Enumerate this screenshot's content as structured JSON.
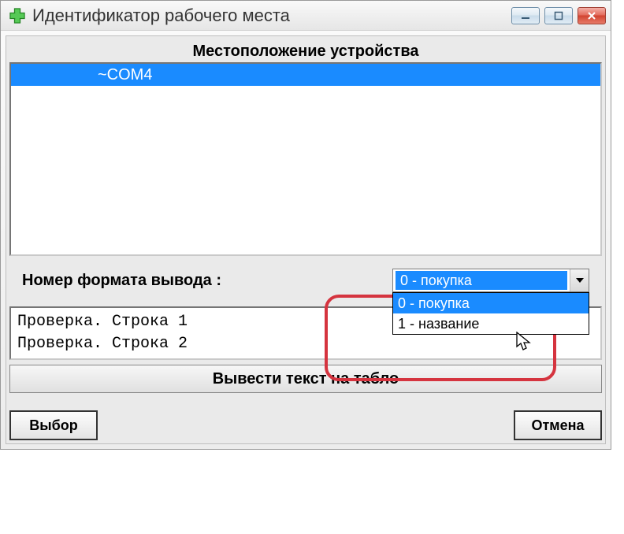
{
  "title": "Идентификатор рабочего места",
  "group_title": "Местоположение устройства",
  "list_item": "~COM4",
  "format_label": "Номер формата вывода :",
  "combo": {
    "selected": "0 - покупка",
    "options": [
      "0 - покупка",
      "1 - название"
    ]
  },
  "preview": {
    "line1": "Проверка. Строка 1",
    "line2": "Проверка. Строка 2"
  },
  "display_button": "Вывести текст на табло",
  "select_button": "Выбор",
  "cancel_button": "Отмена"
}
